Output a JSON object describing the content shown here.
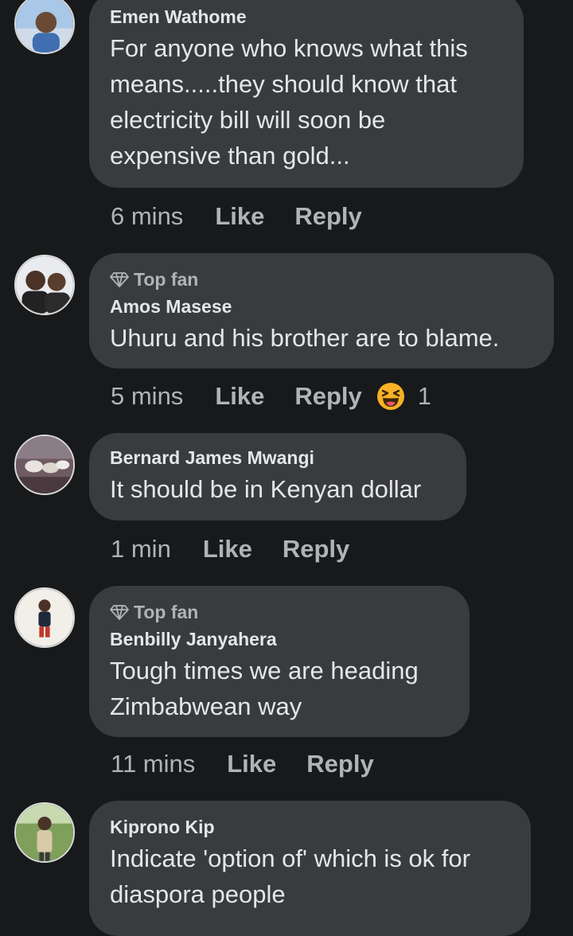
{
  "comments": [
    {
      "name": "Emen Wathome",
      "badge": "",
      "text": "For anyone who knows what this\nmeans.....they should know that\nelectricity bill will soon be\nexpensive than gold...",
      "time": "6 mins",
      "like": "Like",
      "reply": "Reply",
      "reaction_count": ""
    },
    {
      "name": "Amos Masese",
      "badge": "Top fan",
      "text": "Uhuru and his brother are to blame.",
      "time": "5 mins",
      "like": "Like",
      "reply": "Reply",
      "reaction_icon": "laughing-emoji",
      "reaction_count": "1"
    },
    {
      "name": "Bernard James Mwangi",
      "badge": "",
      "text": "It should be in Kenyan dollar",
      "time": "1 min",
      "like": "Like",
      "reply": "Reply",
      "reaction_count": ""
    },
    {
      "name": "Benbilly Janyahera",
      "badge": "Top fan",
      "text": "Tough times we are heading\nZimbabwean way",
      "time": "11 mins",
      "like": "Like",
      "reply": "Reply",
      "reaction_count": ""
    },
    {
      "name": "Kiprono Kip",
      "badge": "",
      "text": "Indicate 'option of' which is ok for\ndiaspora people",
      "time": "",
      "like": "",
      "reply": "",
      "reaction_count": ""
    }
  ],
  "colors": {
    "background": "#18191a",
    "bubble": "#3a3b3c",
    "primary_text": "#e4e6eb",
    "secondary_text": "#b0b3b8"
  }
}
